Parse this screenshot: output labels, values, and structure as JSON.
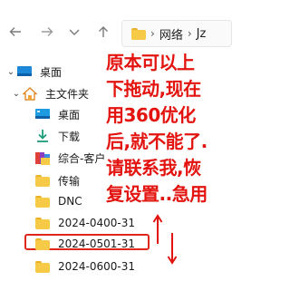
{
  "address": {
    "path_first": "网络",
    "path_second": "Jz"
  },
  "tree": {
    "desktop_root": "桌面",
    "home": "主文件夹",
    "items": [
      {
        "label": "桌面",
        "icon": "desktop-icon"
      },
      {
        "label": "下载",
        "icon": "download-icon"
      },
      {
        "label": "综合-客户",
        "icon": "library-folder-icon"
      },
      {
        "label": "传输",
        "icon": "folder-icon"
      },
      {
        "label": "DNC",
        "icon": "folder-icon"
      },
      {
        "label": "2024-0400-31",
        "icon": "folder-icon"
      },
      {
        "label": "2024-0501-31",
        "icon": "folder-icon"
      },
      {
        "label": "2024-0600-31",
        "icon": "folder-icon"
      }
    ]
  },
  "annotation": {
    "lines": [
      "原本可以上",
      "下拖动,现在",
      "用360优化",
      "后,就不能了.",
      "请联系我,恢",
      "复设置..急用"
    ]
  },
  "colors": {
    "annotation": "#e3140f",
    "folder": "#f6c947",
    "desktop_blue": "#1e88d8"
  }
}
